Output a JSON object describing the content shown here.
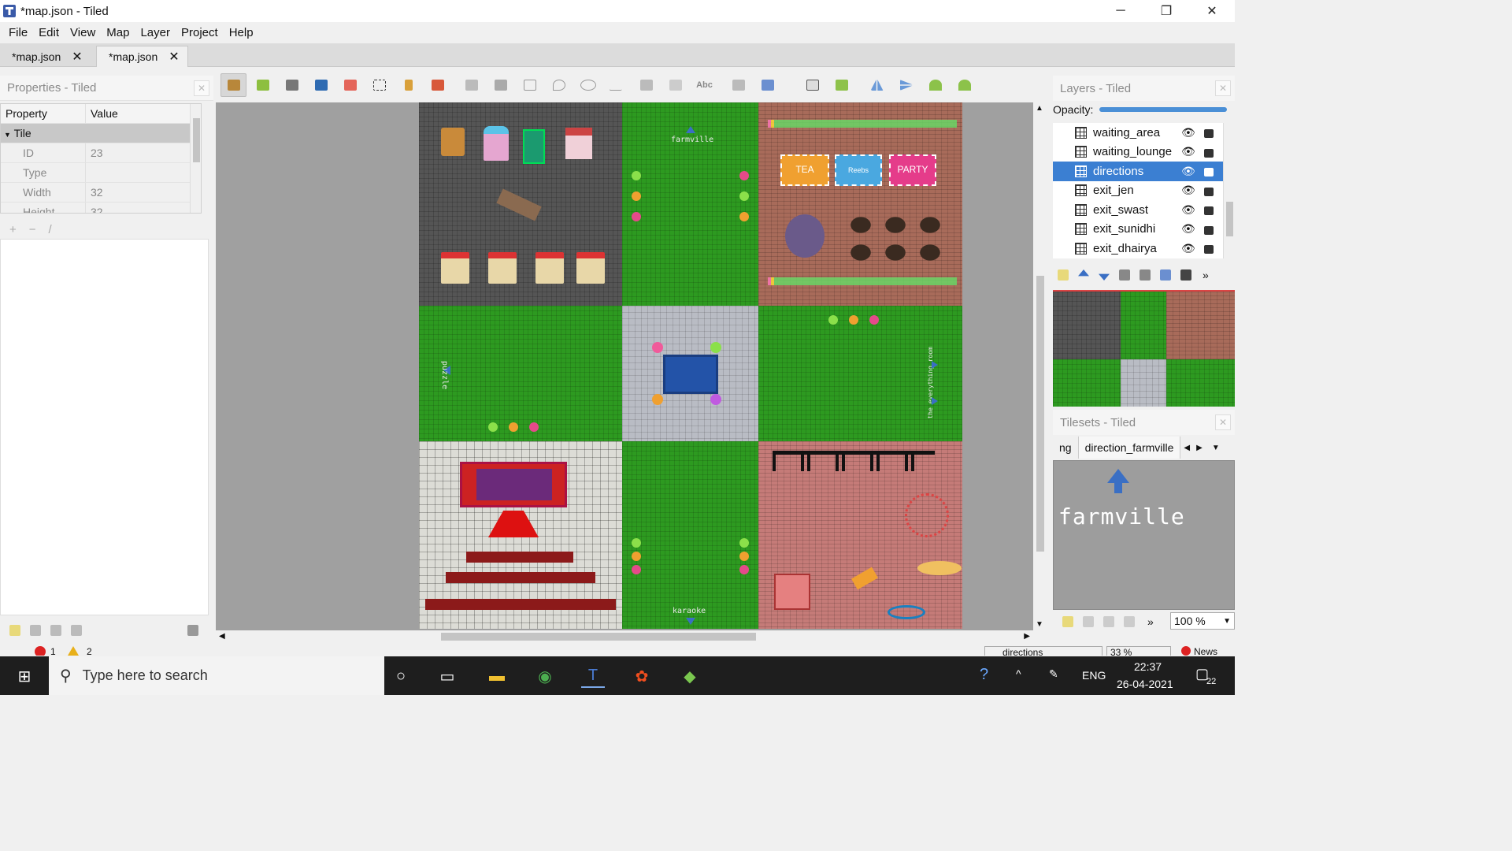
{
  "window": {
    "title": "*map.json - Tiled",
    "minimize_label": "─",
    "restore_label": "❐",
    "close_label": "✕"
  },
  "menu": [
    "File",
    "Edit",
    "View",
    "Map",
    "Layer",
    "Project",
    "Help"
  ],
  "tabs": [
    {
      "label": "*map.json",
      "active": false
    },
    {
      "label": "*map.json",
      "active": true
    }
  ],
  "properties": {
    "title": "Properties - Tiled",
    "columns": [
      "Property",
      "Value"
    ],
    "group": "Tile",
    "rows": [
      {
        "name": "ID",
        "value": "23"
      },
      {
        "name": "Type",
        "value": ""
      },
      {
        "name": "Width",
        "value": "32"
      },
      {
        "name": "Height",
        "value": "32"
      }
    ]
  },
  "toolbar_icons": [
    "stamp-brush-icon",
    "terrain-brush-icon",
    "bucket-fill-icon",
    "shape-fill-icon",
    "eraser-icon",
    "rectangle-select-icon",
    "magic-wand-icon",
    "select-same-tile-icon",
    "select-objects-icon",
    "edit-polygons-icon",
    "insert-rectangle-icon",
    "insert-point-icon",
    "insert-ellipse-icon",
    "insert-polygon-icon",
    "insert-tile-icon",
    "insert-template-icon",
    "insert-text-icon",
    "random-mode-icon",
    "wang-fill-icon",
    "dice-icon",
    "stamp-palette-icon",
    "flip-horizontal-icon",
    "flip-vertical-icon",
    "rotate-left-icon",
    "rotate-right-icon"
  ],
  "map": {
    "labels": {
      "farmville": "farmville",
      "puzzle": "puzzle",
      "everything_room": "the everything room",
      "karaoke": "karaoke",
      "sign_left": "TEA",
      "sign_mid": "Reebs",
      "sign_right": "PARTY"
    }
  },
  "layers": {
    "title": "Layers - Tiled",
    "opacity_label": "Opacity:",
    "items": [
      {
        "name": "waiting_area",
        "selected": false
      },
      {
        "name": "waiting_lounge",
        "selected": false
      },
      {
        "name": "directions",
        "selected": true
      },
      {
        "name": "exit_jen",
        "selected": false
      },
      {
        "name": "exit_swast",
        "selected": false
      },
      {
        "name": "exit_sunidhi",
        "selected": false
      },
      {
        "name": "exit_dhairya",
        "selected": false
      }
    ]
  },
  "tilesets": {
    "title": "Tilesets - Tiled",
    "tab_prev": "ng",
    "tab_current": "direction_farmville",
    "preview_text": "farmville",
    "zoom": "100 %"
  },
  "statusbar": {
    "errors": "1",
    "warnings": "2",
    "layer": "directions",
    "zoom": "33 %",
    "news": "News"
  },
  "taskbar": {
    "search_placeholder": "Type here to search",
    "language": "ENG",
    "time": "22:37",
    "date": "26-04-2021",
    "notifications": "22"
  },
  "colors": {
    "selection": "#3b7fd2",
    "grass": "#2d9a20",
    "arrow": "#3a6fc4"
  }
}
